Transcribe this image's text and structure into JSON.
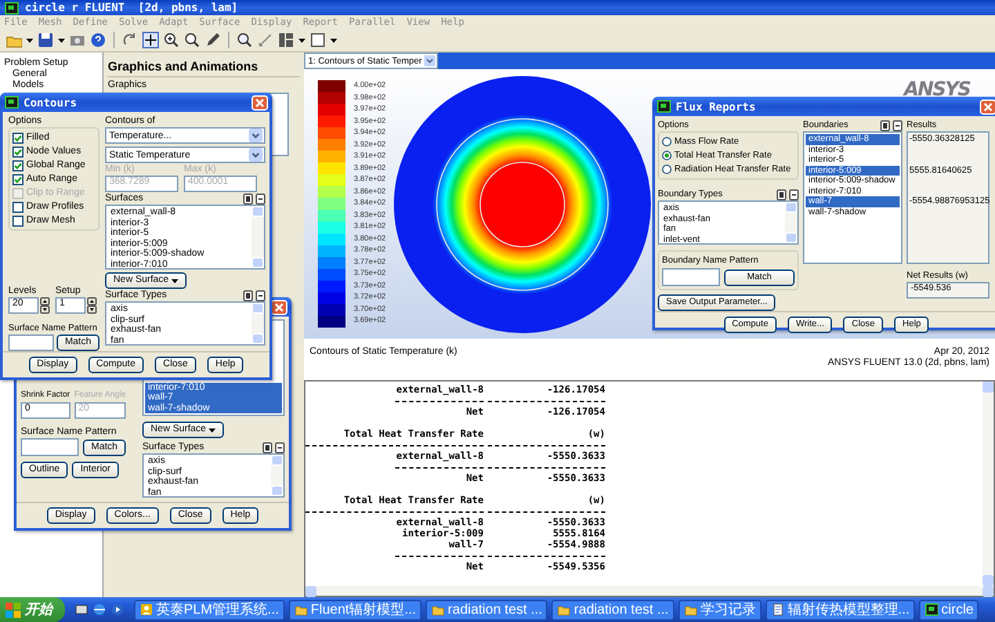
{
  "window": {
    "title": "circle r FLUENT  [2d, pbns, lam]"
  },
  "menu": [
    "File",
    "Mesh",
    "Define",
    "Solve",
    "Adapt",
    "Surface",
    "Display",
    "Report",
    "Parallel",
    "View",
    "Help"
  ],
  "tree": {
    "label": "Problem Setup",
    "children": [
      {
        "label": "General"
      },
      {
        "label": "Models"
      }
    ]
  },
  "task_page": {
    "title": "Graphics and Animations",
    "graphics_label": "Graphics"
  },
  "graphics": {
    "view": "1: Contours of Static Temper",
    "logo": "ANSYS",
    "legend": [
      "4.00e+02",
      "3.98e+02",
      "3.97e+02",
      "3.95e+02",
      "3.94e+02",
      "3.92e+02",
      "3.91e+02",
      "3.89e+02",
      "3.87e+02",
      "3.86e+02",
      "3.84e+02",
      "3.83e+02",
      "3.81e+02",
      "3.80e+02",
      "3.78e+02",
      "3.77e+02",
      "3.75e+02",
      "3.73e+02",
      "3.72e+02",
      "3.70e+02",
      "3.69e+02"
    ],
    "caption": "Contours of Static Temperature (k)",
    "date": "Apr 20, 2012",
    "version": "ANSYS FLUENT 13.0 (2d, pbns, lam)"
  },
  "console": {
    "lines": [
      {
        "kind": "row",
        "name": "external_wall-8",
        "value": "-126.17054"
      },
      {
        "kind": "rule"
      },
      {
        "kind": "row",
        "name": "Net",
        "value": "-126.17054"
      },
      {
        "kind": "blank"
      },
      {
        "kind": "row",
        "name": "Total Heat Transfer Rate",
        "value": "(w)"
      },
      {
        "kind": "long-rule"
      },
      {
        "kind": "row",
        "name": "external_wall-8",
        "value": "-5550.3633"
      },
      {
        "kind": "rule"
      },
      {
        "kind": "row",
        "name": "Net",
        "value": "-5550.3633"
      },
      {
        "kind": "blank"
      },
      {
        "kind": "row",
        "name": "Total Heat Transfer Rate",
        "value": "(w)"
      },
      {
        "kind": "long-rule"
      },
      {
        "kind": "row",
        "name": "external_wall-8",
        "value": "-5550.3633"
      },
      {
        "kind": "row",
        "name": "interior-5:009",
        "value": "5555.8164"
      },
      {
        "kind": "row",
        "name": "wall-7",
        "value": "-5554.9888"
      },
      {
        "kind": "rule"
      },
      {
        "kind": "row",
        "name": "Net",
        "value": "-5549.5356"
      }
    ]
  },
  "contours_dialog": {
    "title": "Contours",
    "options_label": "Options",
    "options": [
      {
        "label": "Filled",
        "checked": true,
        "disabled": false
      },
      {
        "label": "Node Values",
        "checked": true,
        "disabled": false
      },
      {
        "label": "Global Range",
        "checked": true,
        "disabled": false
      },
      {
        "label": "Auto Range",
        "checked": true,
        "disabled": false
      },
      {
        "label": "Clip to Range",
        "checked": false,
        "disabled": true
      },
      {
        "label": "Draw Profiles",
        "checked": false,
        "disabled": false
      },
      {
        "label": "Draw Mesh",
        "checked": false,
        "disabled": false
      }
    ],
    "contours_of_label": "Contours of",
    "contours_of": "Temperature...",
    "quantity": "Static Temperature",
    "min_label": "Min (k)",
    "min": {
      "value": "368.7289",
      "disabled": true
    },
    "max_label": "Max (k)",
    "max": {
      "value": "400.0001",
      "disabled": true
    },
    "surfaces_label": "Surfaces",
    "surfaces": [
      {
        "label": "external_wall-8",
        "selected": false
      },
      {
        "label": "interior-3",
        "selected": false
      },
      {
        "label": "interior-5",
        "selected": false
      },
      {
        "label": "interior-5:009",
        "selected": false
      },
      {
        "label": "interior-5:009-shadow",
        "selected": false
      },
      {
        "label": "interior-7:010",
        "selected": false
      }
    ],
    "levels_label": "Levels",
    "levels": "20",
    "setup_label": "Setup",
    "setup": "1",
    "pattern_label": "Surface Name Pattern",
    "match": "Match",
    "new_surface": "New Surface",
    "types_label": "Surface Types",
    "types": [
      "axis",
      "clip-surf",
      "exhaust-fan",
      "fan"
    ],
    "buttons": [
      "Display",
      "Compute",
      "Close",
      "Help"
    ]
  },
  "mesh_dialog": {
    "surfaces": [
      {
        "label": "interior-7:010",
        "selected": true
      },
      {
        "label": "wall-7",
        "selected": true
      },
      {
        "label": "wall-7-shadow",
        "selected": true
      }
    ],
    "shrink_label": "Shrink Factor",
    "shrink": {
      "value": "0",
      "disabled": false
    },
    "feature_label": "Feature Angle",
    "feature": {
      "value": "20",
      "disabled": true
    },
    "pattern_label": "Surface Name Pattern",
    "match": "Match",
    "outline": "Outline",
    "interior": "Interior",
    "new_surface": "New Surface",
    "types_label": "Surface Types",
    "types": [
      "axis",
      "clip-surf",
      "exhaust-fan",
      "fan"
    ],
    "buttons": [
      "Display",
      "Colors...",
      "Close",
      "Help"
    ]
  },
  "flux_dialog": {
    "title": "Flux Reports",
    "options_label": "Options",
    "options": [
      {
        "label": "Mass Flow Rate",
        "selected": false
      },
      {
        "label": "Total Heat Transfer Rate",
        "selected": true
      },
      {
        "label": "Radiation Heat Transfer Rate",
        "selected": false
      }
    ],
    "types_label": "Boundary Types",
    "types": [
      "axis",
      "exhaust-fan",
      "fan",
      "inlet-vent"
    ],
    "pattern_label": "Boundary Name Pattern",
    "match": "Match",
    "save": "Save Output Parameter...",
    "boundaries_label": "Boundaries",
    "boundaries": [
      {
        "label": "external_wall-8",
        "selected": true
      },
      {
        "label": "interior-3",
        "selected": false
      },
      {
        "label": "interior-5",
        "selected": false
      },
      {
        "label": "interior-5:009",
        "selected": true
      },
      {
        "label": "interior-5:009-shadow",
        "selected": false
      },
      {
        "label": "interior-7:010",
        "selected": false
      },
      {
        "label": "wall-7",
        "selected": true
      },
      {
        "label": "wall-7-shadow",
        "selected": false
      }
    ],
    "results_label": "Results",
    "results": [
      "-5550.36328125",
      "5555.81640625",
      "-5554.98876953125"
    ],
    "net_label": "Net Results (w)",
    "net": "-5549.536",
    "buttons": [
      "Compute",
      "Write...",
      "Close",
      "Help"
    ]
  },
  "taskbar": {
    "start": "开始",
    "tasks": [
      {
        "label": "英泰PLM管理系统...",
        "kind": "app"
      },
      {
        "label": "Fluent辐射模型...",
        "kind": "folder"
      },
      {
        "label": "radiation test ...",
        "kind": "folder"
      },
      {
        "label": "radiation test ...",
        "kind": "folder"
      },
      {
        "label": "学习记录",
        "kind": "folder"
      },
      {
        "label": "辐射传热模型整理...",
        "kind": "document"
      },
      {
        "label": "circle",
        "kind": "fluent"
      }
    ]
  }
}
